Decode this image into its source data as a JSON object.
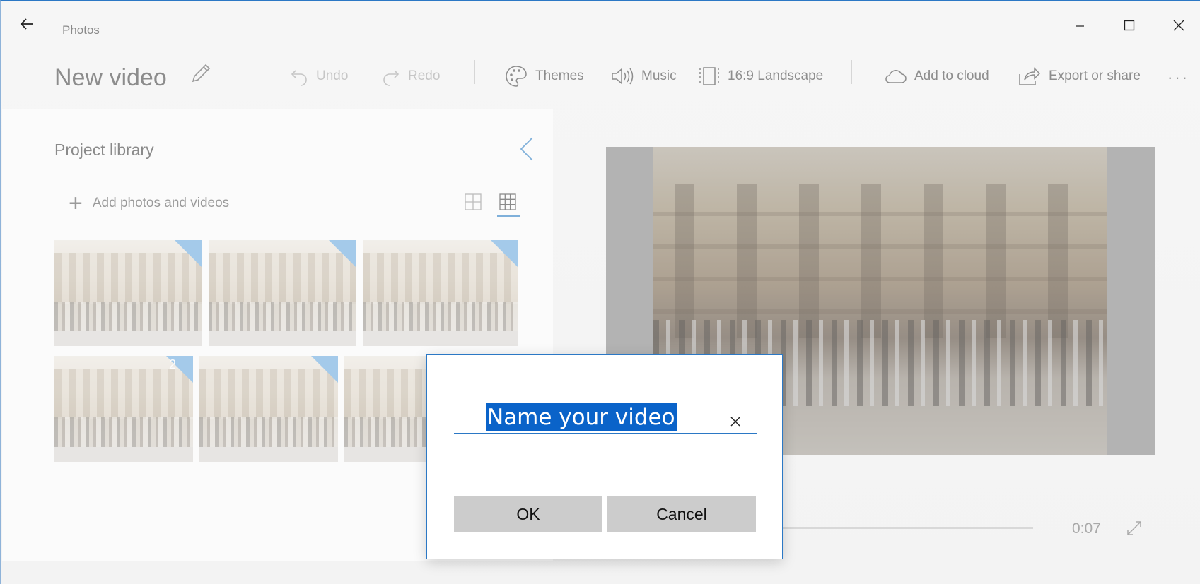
{
  "app": {
    "title": "Photos"
  },
  "window_controls": {
    "minimize_icon": "minimize-icon",
    "maximize_icon": "maximize-icon",
    "close_icon": "close-icon"
  },
  "toolbar": {
    "video_title": "New video",
    "undo_label": "Undo",
    "redo_label": "Redo",
    "themes_label": "Themes",
    "music_label": "Music",
    "aspect_label": "16:9 Landscape",
    "cloud_label": "Add to cloud",
    "export_label": "Export or share",
    "more_label": "···"
  },
  "library": {
    "title": "Project library",
    "add_label": "Add photos and videos",
    "thumbnails": [
      {
        "badge": ""
      },
      {
        "badge": ""
      },
      {
        "badge": ""
      },
      {
        "badge": "2"
      },
      {
        "badge": ""
      },
      {
        "badge": ""
      }
    ]
  },
  "player": {
    "time": "0:07"
  },
  "dialog": {
    "input_value": "Name your video",
    "ok_label": "OK",
    "cancel_label": "Cancel"
  },
  "colors": {
    "accent": "#2b78c5",
    "selection": "#0a63c9",
    "button_bg": "#cccccc"
  }
}
